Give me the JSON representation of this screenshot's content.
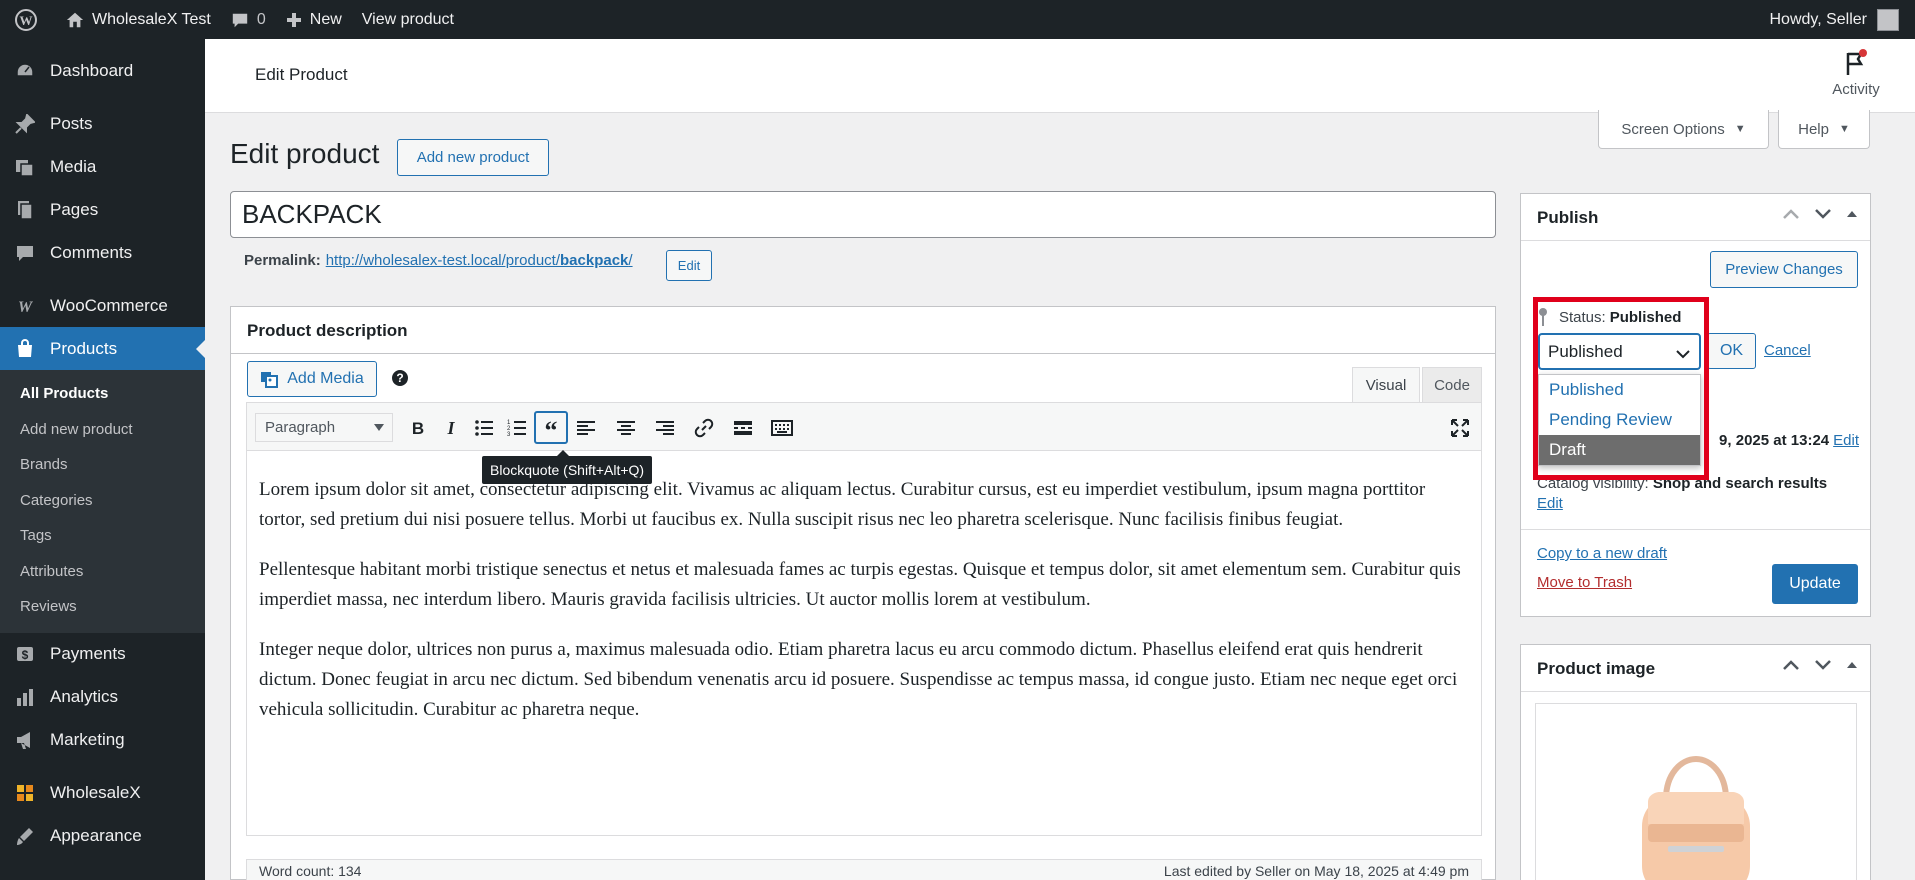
{
  "admin_bar": {
    "site_name": "WholesaleX Test",
    "comments_count": "0",
    "new_label": "New",
    "view_product_label": "View product",
    "howdy": "Howdy, Seller"
  },
  "sidebar": {
    "items": [
      {
        "label": "Dashboard",
        "icon": "dashboard-icon"
      },
      {
        "label": "Posts",
        "icon": "pin-icon"
      },
      {
        "label": "Media",
        "icon": "media-icon"
      },
      {
        "label": "Pages",
        "icon": "pages-icon"
      },
      {
        "label": "Comments",
        "icon": "comment-icon"
      },
      {
        "label": "WooCommerce",
        "icon": "woocommerce-icon"
      },
      {
        "label": "Products",
        "icon": "products-icon"
      },
      {
        "label": "Payments",
        "icon": "payments-icon"
      },
      {
        "label": "Analytics",
        "icon": "analytics-icon"
      },
      {
        "label": "Marketing",
        "icon": "marketing-icon"
      },
      {
        "label": "WholesaleX",
        "icon": "wholesalex-icon"
      },
      {
        "label": "Appearance",
        "icon": "appearance-icon"
      }
    ],
    "products_submenu": [
      "All Products",
      "Add new product",
      "Brands",
      "Categories",
      "Tags",
      "Attributes",
      "Reviews"
    ]
  },
  "header": {
    "title": "Edit Product",
    "activity_label": "Activity"
  },
  "screen_options_label": "Screen Options",
  "help_label": "Help",
  "page": {
    "heading": "Edit product",
    "add_new_label": "Add new product",
    "product_title": "BACKPACK",
    "permalink_label": "Permalink:",
    "permalink_base": "http://wholesalex-test.local/product/",
    "permalink_slug": "backpack",
    "permalink_trailing": "/",
    "permalink_edit_label": "Edit"
  },
  "editor": {
    "box_title": "Product description",
    "add_media_label": "Add Media",
    "help_glyph": "?",
    "tab_visual": "Visual",
    "tab_code": "Code",
    "format_select": "Paragraph",
    "tooltip": "Blockquote (Shift+Alt+Q)",
    "paragraphs": [
      "Lorem ipsum dolor sit amet, consectetur adipiscing elit. Vivamus ac aliquam lectus. Curabitur cursus, est eu imperdiet vestibulum, ipsum magna porttitor tortor, sed pretium dui nisi posuere tellus. Morbi ut faucibus ex. Nulla suscipit risus nec leo pharetra scelerisque. Nunc facilisis finibus feugiat.",
      "Pellentesque habitant morbi tristique senectus et netus et malesuada fames ac turpis egestas. Quisque et tempus dolor, sit amet elementum sem. Curabitur quis imperdiet massa, nec interdum libero. Mauris gravida facilisis ultricies. Ut auctor mollis lorem at vestibulum.",
      "Integer neque dolor, ultrices non purus a, maximus malesuada odio. Etiam pharetra lacus eu arcu commodo dictum. Phasellus eleifend erat quis hendrerit dictum. Donec feugiat in arcu nec dictum. Sed bibendum venenatis arcu id posuere. Suspendisse ac tempus massa, id congue justo. Etiam nec neque eget orci vehicula sollicitudin. Curabitur ac pharetra neque."
    ],
    "word_count": "Word count: 134",
    "last_edited": "Last edited by Seller on May 18, 2025 at 4:49 pm"
  },
  "publish": {
    "title": "Publish",
    "preview_label": "Preview Changes",
    "status_label": "Status:",
    "status_value": "Published",
    "select_value": "Published",
    "ok_label": "OK",
    "cancel_label": "Cancel",
    "options": [
      "Published",
      "Pending Review",
      "Draft"
    ],
    "published_on_partial": "9, 2025 at 13:24",
    "published_edit": "Edit",
    "catalog_partial": "Catalog visibility:",
    "catalog_value": "Shop and search results",
    "catalog_edit": "Edit",
    "copy_draft": "Copy to a new draft",
    "move_trash": "Move to Trash",
    "update_label": "Update"
  },
  "product_image": {
    "title": "Product image"
  },
  "colors": {
    "admin_dark": "#1d2327",
    "accent_blue": "#2271b1",
    "highlight_red": "#e0001b",
    "trash_red": "#b32d2e"
  }
}
